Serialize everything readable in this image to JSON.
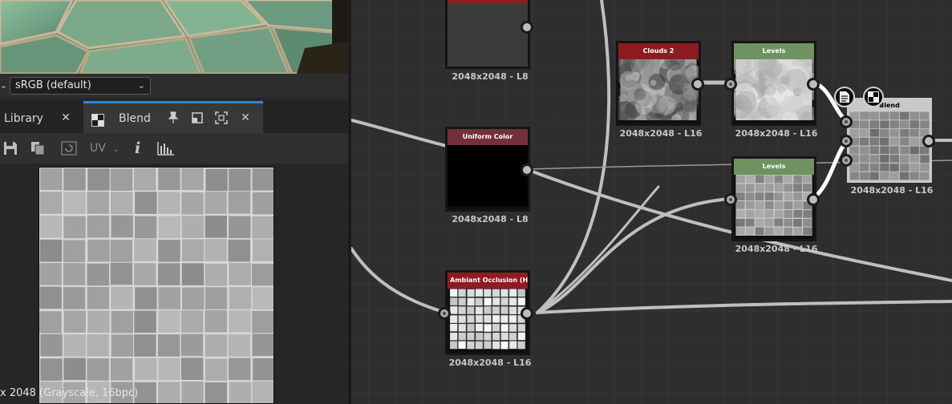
{
  "colorspace": {
    "selected": "sRGB (default)"
  },
  "tabs": [
    {
      "label": "Library"
    },
    {
      "label": "Blend"
    }
  ],
  "toolbar": {
    "uv_label": "UV",
    "info_label": "i"
  },
  "view2d": {
    "status": "x 2048 (Grayscale, 16bpc)"
  },
  "nodes": [
    {
      "id": "top",
      "title": "",
      "caption": "2048x2048 - L8",
      "head_color": "#8d1c22"
    },
    {
      "id": "uniform",
      "title": "Uniform Color",
      "caption": "2048x2048 - L8",
      "head_color": "#73303b"
    },
    {
      "id": "ao",
      "title": "Ambiant Occlusion (HB...",
      "caption": "2048x2048 - L16",
      "head_color": "#8d1c22"
    },
    {
      "id": "clouds",
      "title": "Clouds 2",
      "caption": "2048x2048 - L16",
      "head_color": "#8d1c22"
    },
    {
      "id": "levels1",
      "title": "Levels",
      "caption": "2048x2048 - L16",
      "head_color": "#6e9361"
    },
    {
      "id": "levels2",
      "title": "Levels",
      "caption": "2048x2048 - L16",
      "head_color": "#6e9361"
    },
    {
      "id": "blend",
      "title": "Blend",
      "caption": "2048x2048 - L16",
      "head_color": "#9c9c9c"
    }
  ],
  "colors": {
    "accent": "#2f86d8",
    "wire": "#bfbfbf",
    "graph_bg": "#2e2e2e"
  }
}
